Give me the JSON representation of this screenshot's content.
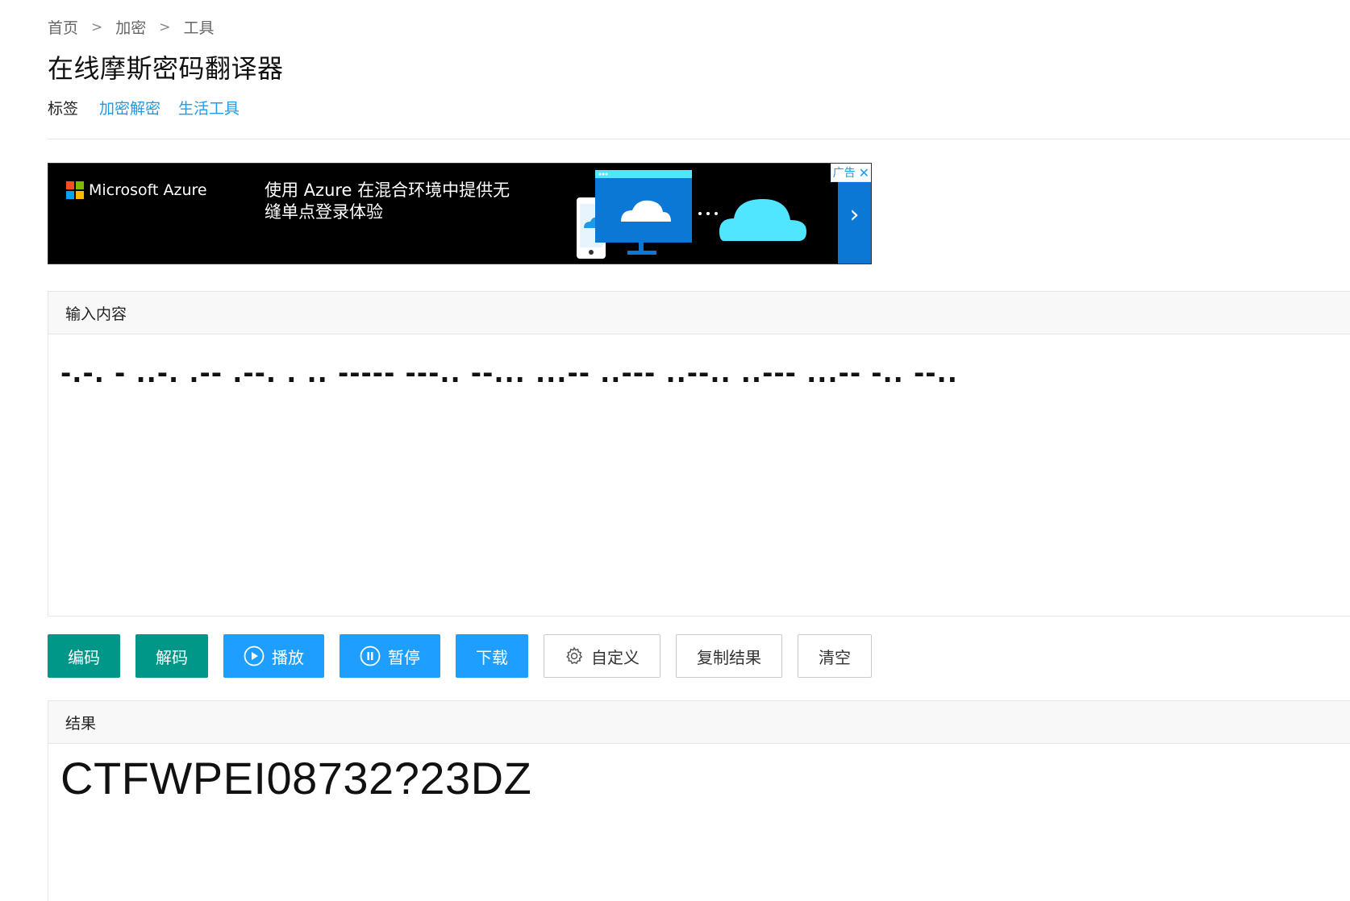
{
  "breadcrumb": {
    "home": "首页",
    "sep": ">",
    "category": "加密",
    "section": "工具"
  },
  "page": {
    "title": "在线摩斯密码翻译器"
  },
  "tags": {
    "label": "标签",
    "items": [
      "加密解密",
      "生活工具"
    ]
  },
  "ad": {
    "brand": "Microsoft Azure",
    "line1": "使用 Azure 在混合环境中提供无",
    "line2": "缝单点登录体验",
    "badge": "广告",
    "close": "✕",
    "arrow": "›",
    "colors": {
      "background": "#000000",
      "arrow_bg": "#0a78d4",
      "cloud": "#50e6ff",
      "monitor": "#0a78d4"
    }
  },
  "input": {
    "header": "输入内容",
    "value": "-.-. - ..-. .-- .--. . .. ----- ---.. --... ...-- ..--- ..--.. ..--- ...-- -.. --.."
  },
  "buttons": {
    "encode": "编码",
    "decode": "解码",
    "play": "播放",
    "pause": "暂停",
    "download": "下载",
    "custom": "自定义",
    "copy": "复制结果",
    "clear": "清空"
  },
  "result": {
    "header": "结果",
    "value": "CTFWPEI08732?23DZ"
  },
  "colors": {
    "teal": "#009688",
    "blue": "#1e9fff",
    "link": "#1e9be6"
  }
}
